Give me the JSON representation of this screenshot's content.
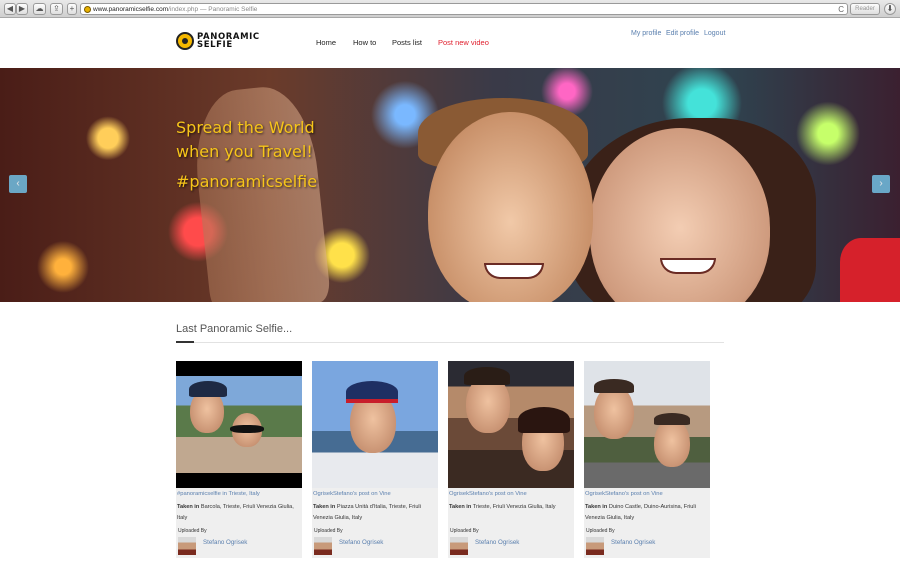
{
  "browser": {
    "back": "◀",
    "forward": "▶",
    "cloud": "☁",
    "share": "⇪",
    "add": "+",
    "url_domain": "www.panoramicselfie.com",
    "url_rest": "/index.php — Panoramic Selfie",
    "reload": "C",
    "reader": "Reader",
    "download": "⬇"
  },
  "header": {
    "logo_line1": "PANORAMIC",
    "logo_line2": "SELFIE",
    "nav": [
      "Home",
      "How to",
      "Posts list",
      "Post new video"
    ],
    "user_nav": [
      "My profile",
      "Edit profile",
      "Logout"
    ]
  },
  "hero": {
    "line1": "Spread the World",
    "line2": "when you Travel!",
    "hashtag": "#panoramicselfie",
    "prev": "‹",
    "next": "›"
  },
  "section": {
    "title": "Last Panoramic Selfie..."
  },
  "cards": [
    {
      "title": "#panoramicselfie in Trieste, Italy",
      "taken_label": "Taken in",
      "taken": "Barcola, Trieste, Friuli Venezia Giulia, Italy",
      "uploaded_by": "Uploaded By",
      "user": "Stefano Ogrisek"
    },
    {
      "title": "OgrisekStefano's post on Vine",
      "taken_label": "Taken in",
      "taken": "Piazza Unità d'Italia, Trieste, Friuli Venezia Giulia, Italy",
      "uploaded_by": "Uploaded By",
      "user": "Stefano Ogrisek"
    },
    {
      "title": "OgrisekStefano's post on Vine",
      "taken_label": "Taken in",
      "taken": "Trieste, Friuli Venezia Giulia, Italy",
      "uploaded_by": "Uploaded By",
      "user": "Stefano Ogrisek"
    },
    {
      "title": "OgrisekStefano's post on Vine",
      "taken_label": "Taken in",
      "taken": "Duino Castle, Duino-Aurisina, Friuli Venezia Giulia, Italy",
      "uploaded_by": "Uploaded By",
      "user": "Stefano Ogrisek"
    }
  ]
}
